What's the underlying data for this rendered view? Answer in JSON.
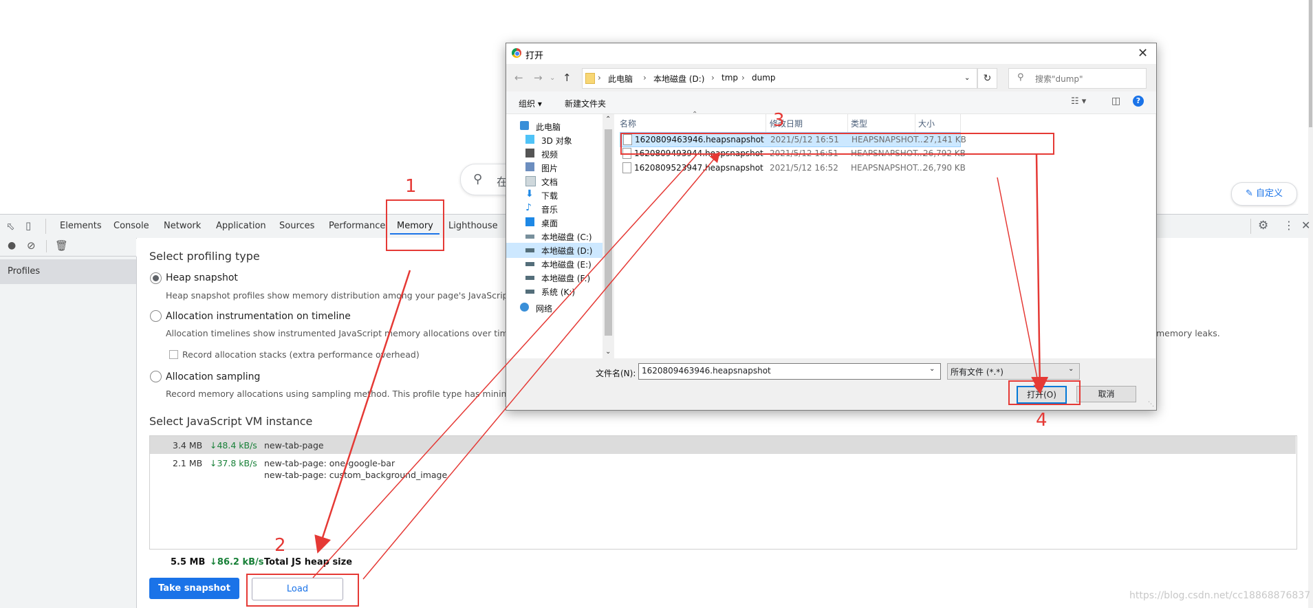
{
  "browser": {
    "search_placeholder": "在",
    "customize_label": "自定义"
  },
  "devtools": {
    "tabs": [
      "Elements",
      "Console",
      "Network",
      "Application",
      "Sources",
      "Performance",
      "Memory",
      "Lighthouse"
    ],
    "active_tab": "Memory",
    "sidebar": {
      "profiles_label": "Profiles"
    },
    "memory": {
      "profiling_title": "Select profiling type",
      "options": [
        {
          "label": "Heap snapshot",
          "desc": "Heap snapshot profiles show memory distribution among your page's JavaScript obje",
          "selected": true
        },
        {
          "label": "Allocation instrumentation on timeline",
          "desc": "Allocation timelines show instrumented JavaScript memory allocations over time. Onc",
          "desc_tail": "memory leaks.",
          "selected": false
        },
        {
          "label": "Allocation sampling",
          "desc": "Record memory allocations using sampling method. This profile type has minimal per",
          "selected": false
        }
      ],
      "record_stacks_label": "Record allocation stacks (extra performance overhead)",
      "vm_title": "Select JavaScript VM instance",
      "vm_instances": [
        {
          "size": "3.4 MB",
          "rate": "↓48.4 kB/s",
          "names": [
            "new-tab-page"
          ]
        },
        {
          "size": "2.1 MB",
          "rate": "↓37.8 kB/s",
          "names": [
            "new-tab-page: one-google-bar",
            "new-tab-page: custom_background_image"
          ]
        }
      ],
      "total": {
        "size": "5.5 MB",
        "rate": "↓86.2 kB/s",
        "label": "Total JS heap size"
      },
      "take_snapshot_label": "Take snapshot",
      "load_label": "Load"
    }
  },
  "dialog": {
    "title": "打开",
    "breadcrumbs": [
      "此电脑",
      "本地磁盘 (D:)",
      "tmp",
      "dump"
    ],
    "search_placeholder": "搜索\"dump\"",
    "organize_label": "组织 ▾",
    "new_folder_label": "新建文件夹",
    "tree": [
      {
        "label": "此电脑",
        "icon": "pc-icon",
        "indent": 0
      },
      {
        "label": "3D 对象",
        "icon": "3d-objects-icon",
        "indent": 1
      },
      {
        "label": "视频",
        "icon": "video-icon",
        "indent": 1
      },
      {
        "label": "图片",
        "icon": "pictures-icon",
        "indent": 1
      },
      {
        "label": "文档",
        "icon": "documents-icon",
        "indent": 1
      },
      {
        "label": "下载",
        "icon": "download-icon",
        "indent": 1
      },
      {
        "label": "音乐",
        "icon": "music-icon",
        "indent": 1
      },
      {
        "label": "桌面",
        "icon": "desktop-icon",
        "indent": 1
      },
      {
        "label": "本地磁盘 (C:)",
        "icon": "drive-icon",
        "indent": 1
      },
      {
        "label": "本地磁盘 (D:)",
        "icon": "drive-icon",
        "indent": 1,
        "selected": true
      },
      {
        "label": "本地磁盘 (E:)",
        "icon": "drive-icon",
        "indent": 1
      },
      {
        "label": "本地磁盘 (F:)",
        "icon": "drive-icon",
        "indent": 1
      },
      {
        "label": "系统 (K:)",
        "icon": "drive-icon",
        "indent": 1
      },
      {
        "label": "网络",
        "icon": "network-icon",
        "indent": 0
      }
    ],
    "columns": [
      "名称",
      "修改日期",
      "类型",
      "大小"
    ],
    "files": [
      {
        "name": "1620809463946.heapsnapshot",
        "date": "2021/5/12 16:51",
        "type": "HEAPSNAPSHOT...",
        "size": "27,141 KB",
        "selected": true
      },
      {
        "name": "1620809493944.heapsnapshot",
        "date": "2021/5/12 16:51",
        "type": "HEAPSNAPSHOT...",
        "size": "26,792 KB"
      },
      {
        "name": "1620809523947.heapsnapshot",
        "date": "2021/5/12 16:52",
        "type": "HEAPSNAPSHOT...",
        "size": "26,790 KB"
      }
    ],
    "filename_label": "文件名(N):",
    "filename_value": "1620809463946.heapsnapshot",
    "filetype_value": "所有文件 (*.*)",
    "open_label": "打开(O)",
    "cancel_label": "取消"
  },
  "annotations": [
    "1",
    "2",
    "3",
    "4"
  ],
  "annotation_color": "#e53935",
  "watermark": "https://blog.csdn.net/cc18868876837",
  "colors": {
    "accent": "#1a73e8",
    "green_rate": "#188038",
    "selection": "#cce8ff"
  }
}
